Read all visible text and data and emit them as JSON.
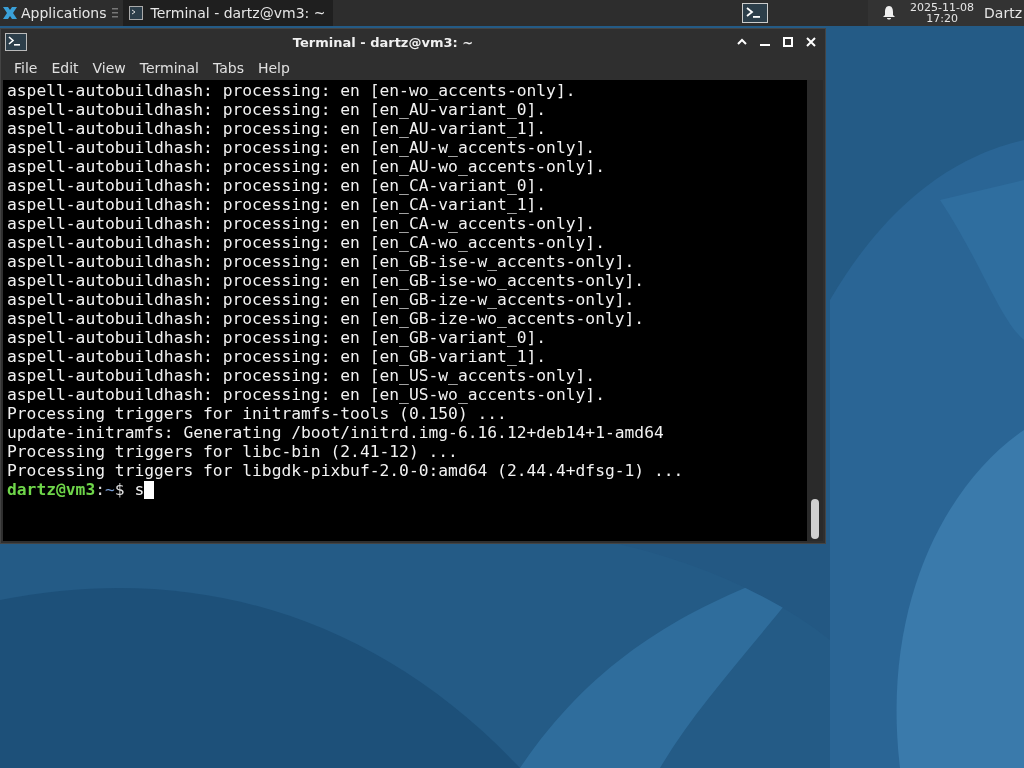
{
  "panel": {
    "apps_menu": {
      "label": "Applications"
    },
    "tasks": [
      {
        "label": "Terminal - dartz@vm3: ~",
        "selected": true
      }
    ],
    "clock": {
      "date": "2025-11-08",
      "time": "17:20"
    },
    "user": "Dartz"
  },
  "window": {
    "title": "Terminal - dartz@vm3: ~",
    "menu": [
      "File",
      "Edit",
      "View",
      "Terminal",
      "Tabs",
      "Help"
    ],
    "lines": [
      "aspell-autobuildhash: processing: en [en-wo_accents-only].",
      "aspell-autobuildhash: processing: en [en_AU-variant_0].",
      "aspell-autobuildhash: processing: en [en_AU-variant_1].",
      "aspell-autobuildhash: processing: en [en_AU-w_accents-only].",
      "aspell-autobuildhash: processing: en [en_AU-wo_accents-only].",
      "aspell-autobuildhash: processing: en [en_CA-variant_0].",
      "aspell-autobuildhash: processing: en [en_CA-variant_1].",
      "aspell-autobuildhash: processing: en [en_CA-w_accents-only].",
      "aspell-autobuildhash: processing: en [en_CA-wo_accents-only].",
      "aspell-autobuildhash: processing: en [en_GB-ise-w_accents-only].",
      "aspell-autobuildhash: processing: en [en_GB-ise-wo_accents-only].",
      "aspell-autobuildhash: processing: en [en_GB-ize-w_accents-only].",
      "aspell-autobuildhash: processing: en [en_GB-ize-wo_accents-only].",
      "aspell-autobuildhash: processing: en [en_GB-variant_0].",
      "aspell-autobuildhash: processing: en [en_GB-variant_1].",
      "aspell-autobuildhash: processing: en [en_US-w_accents-only].",
      "aspell-autobuildhash: processing: en [en_US-wo_accents-only].",
      "Processing triggers for initramfs-tools (0.150) ...",
      "update-initramfs: Generating /boot/initrd.img-6.16.12+deb14+1-amd64",
      "Processing triggers for libc-bin (2.41-12) ...",
      "Processing triggers for libgdk-pixbuf-2.0-0:amd64 (2.44.4+dfsg-1) ..."
    ],
    "prompt": {
      "user_host": "dartz@vm3",
      "separator": ":",
      "path": "~",
      "symbol": "$",
      "input": "s"
    }
  }
}
